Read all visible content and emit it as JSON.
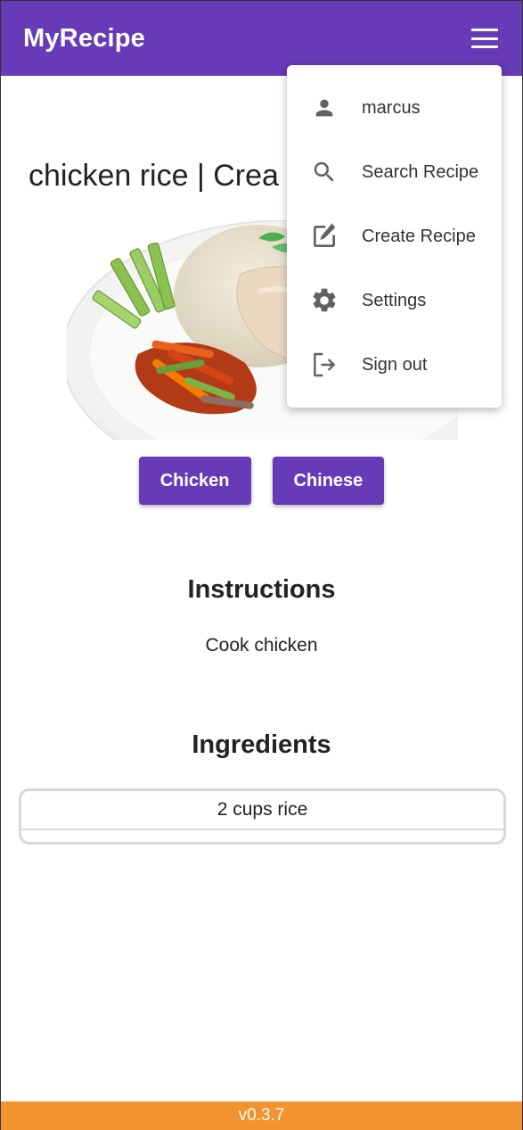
{
  "app": {
    "title": "MyRecipe",
    "version": "v0.3.7"
  },
  "colors": {
    "primary": "#673ab7",
    "footer": "#f39330"
  },
  "recipe": {
    "title": "chicken rice | Crea",
    "tags": [
      "Chicken",
      "Chinese"
    ],
    "instructions_heading": "Instructions",
    "instructions": "Cook chicken",
    "ingredients_heading": "Ingredients",
    "ingredients": [
      "2 cups rice"
    ]
  },
  "menu": {
    "items": [
      {
        "icon": "person-icon",
        "label": "marcus"
      },
      {
        "icon": "search-icon",
        "label": "Search Recipe"
      },
      {
        "icon": "edit-icon",
        "label": "Create Recipe"
      },
      {
        "icon": "gear-icon",
        "label": "Settings"
      },
      {
        "icon": "sign-out-icon",
        "label": "Sign out"
      }
    ]
  }
}
